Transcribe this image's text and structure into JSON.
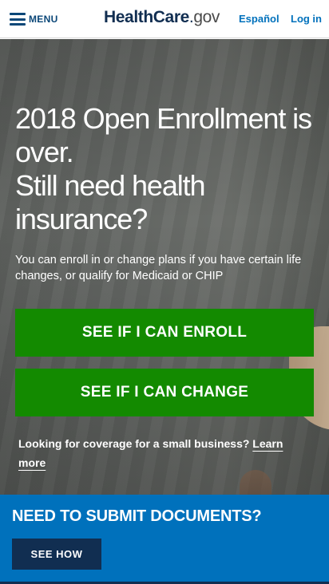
{
  "header": {
    "menu_label": "MENU",
    "logo": {
      "part1": "HealthCare",
      "dot": ".",
      "part2": "gov"
    },
    "lang_label": "Español",
    "login_label": "Log in"
  },
  "hero": {
    "title_line1": "2018 Open Enrollment is over.",
    "title_line2": "Still need health insurance?",
    "text": "You can enroll in or change plans if you have certain life changes, or qualify for Medicaid or CHIP",
    "enroll_label": "SEE IF I CAN ENROLL",
    "change_label": "SEE IF I CAN CHANGE",
    "small_business_text": "Looking for coverage for a small business?",
    "small_business_link": "Learn more"
  },
  "docs_banner": {
    "title": "NEED TO SUBMIT DOCUMENTS?",
    "button_label": "SEE HOW"
  },
  "colors": {
    "brand_blue": "#0071bc",
    "navy": "#112e51",
    "cta_green": "#138a00"
  }
}
